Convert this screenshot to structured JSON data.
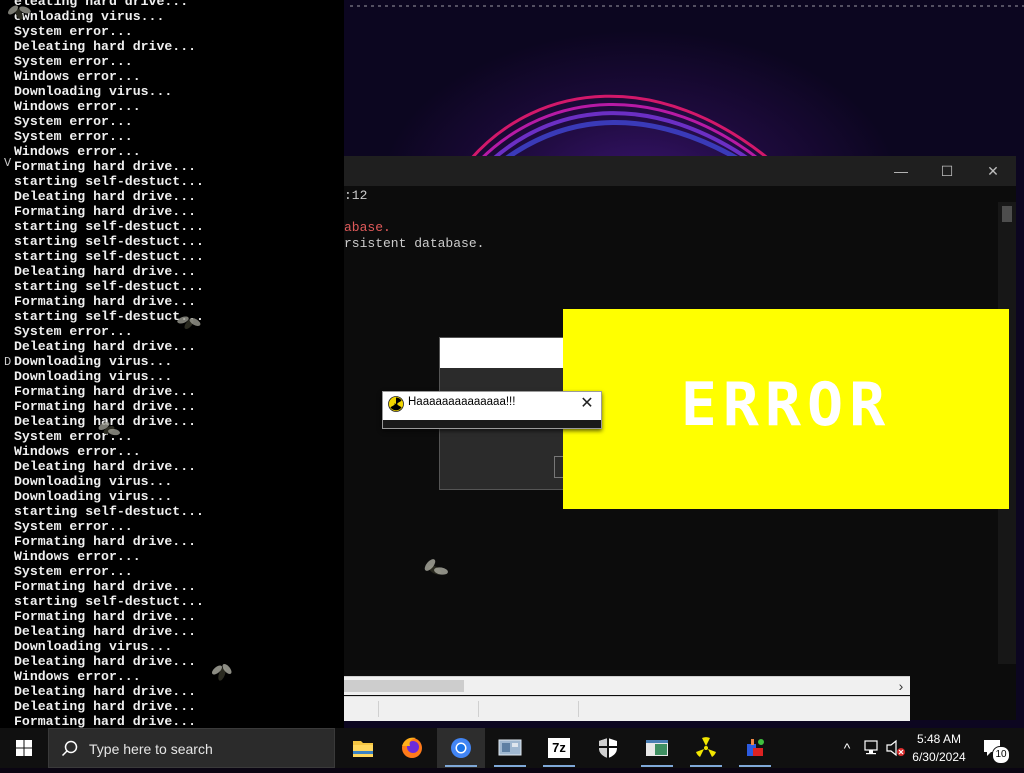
{
  "spam_console": {
    "lines": [
      "eleating hard drive...",
      "ownloading virus...",
      "System error...",
      "Deleating hard drive...",
      "System error...",
      "Windows error...",
      "Downloading virus...",
      "Windows error...",
      "System error...",
      "System error...",
      "Windows error...",
      "Formating hard drive...",
      "starting self-destuct...",
      "Deleating hard drive...",
      "Formating hard drive...",
      "starting self-destuct...",
      "starting self-destuct...",
      "starting self-destuct...",
      "Deleating hard drive...",
      "starting self-destuct...",
      "Formating hard drive...",
      "starting self-destuct...",
      "System error...",
      "Deleating hard drive...",
      "Downloading virus...",
      "Downloading virus...",
      "Formating hard drive...",
      "Formating hard drive...",
      "Deleating hard drive...",
      "System error...",
      "Windows error...",
      "Deleating hard drive...",
      "Downloading virus...",
      "Downloading virus...",
      "starting self-destuct...",
      "System error...",
      "Formating hard drive...",
      "Windows error...",
      "System error...",
      "Formating hard drive...",
      "starting self-destuct...",
      "Formating hard drive...",
      "Deleating hard drive...",
      "Downloading virus...",
      "Deleating hard drive...",
      "Windows error...",
      "Deleating hard drive...",
      "Deleating hard drive...",
      "Formating hard drive..."
    ],
    "side_glyph_1": "V",
    "side_glyph_2": "D"
  },
  "cmd_window": {
    "title_fragment": ":12",
    "output_lines": [
      {
        "text": "abase.",
        "color": "#e05a5a"
      },
      {
        "text": "rsistent database.",
        "color": "#cccccc"
      }
    ],
    "controls": {
      "minimize": "—",
      "maximize": "☐",
      "close": "✕"
    },
    "hscroll_arrow": "›"
  },
  "error_popup": {
    "text": "ERROR",
    "background": "#ffff00",
    "text_color": "#ffffff"
  },
  "msgbox": {
    "title": "Haaaaaaaaaaaaaa!!!",
    "icon": "radiation-icon",
    "close": "✕"
  },
  "taskbar": {
    "search_placeholder": "Type here to search",
    "apps": [
      {
        "name": "file-explorer-icon"
      },
      {
        "name": "firefox-icon"
      },
      {
        "name": "chrome-icon",
        "active": true
      },
      {
        "name": "control-panel-icon"
      },
      {
        "name": "7zip-icon",
        "label": "7z"
      },
      {
        "name": "security-shield-icon"
      },
      {
        "name": "window-app-icon"
      },
      {
        "name": "radiation-app-icon"
      },
      {
        "name": "paint-app-icon"
      }
    ],
    "time": "5:48 AM",
    "date": "6/30/2024",
    "notification_count": "10"
  }
}
